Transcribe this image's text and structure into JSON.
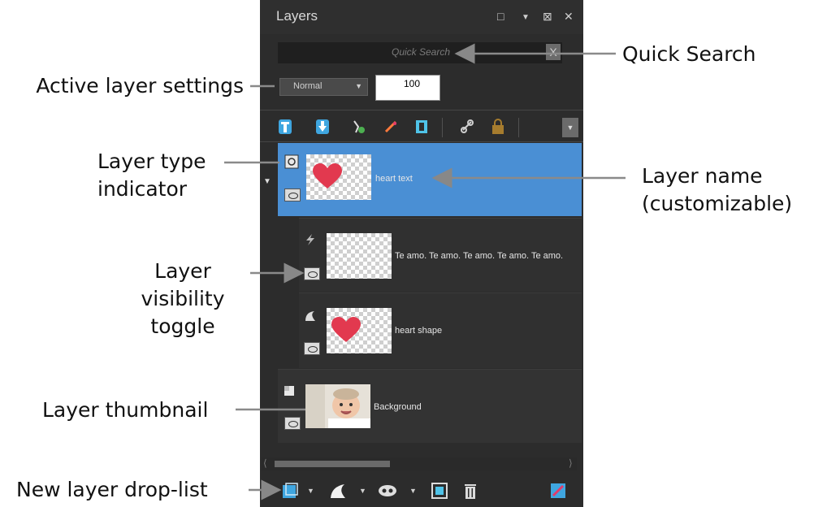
{
  "panel": {
    "title": "Layers",
    "search_placeholder": "Quick Search",
    "search_clear": "X",
    "blend_mode": "Normal",
    "opacity": "100",
    "layers": [
      {
        "name": "heart text",
        "type": "text-group",
        "selected": true
      },
      {
        "name": "Te amo. Te amo. Te amo. Te amo. Te amo.",
        "type": "text"
      },
      {
        "name": "heart shape",
        "type": "vector"
      },
      {
        "name": "Background",
        "type": "raster"
      }
    ]
  },
  "callouts": {
    "quick_search": "Quick Search",
    "active_layer_settings": "Active layer settings",
    "layer_type_indicator": "Layer type\nindicator",
    "layer_name": "Layer name\n(customizable)",
    "layer_visibility_toggle": "Layer\nvisibility\ntoggle",
    "layer_thumbnail": "Layer thumbnail",
    "new_layer_drop_list": "New layer drop-list"
  },
  "colors": {
    "panel_bg": "#2c2c2c",
    "selected_layer": "#4a8fd4",
    "heart": "#e2394f"
  }
}
